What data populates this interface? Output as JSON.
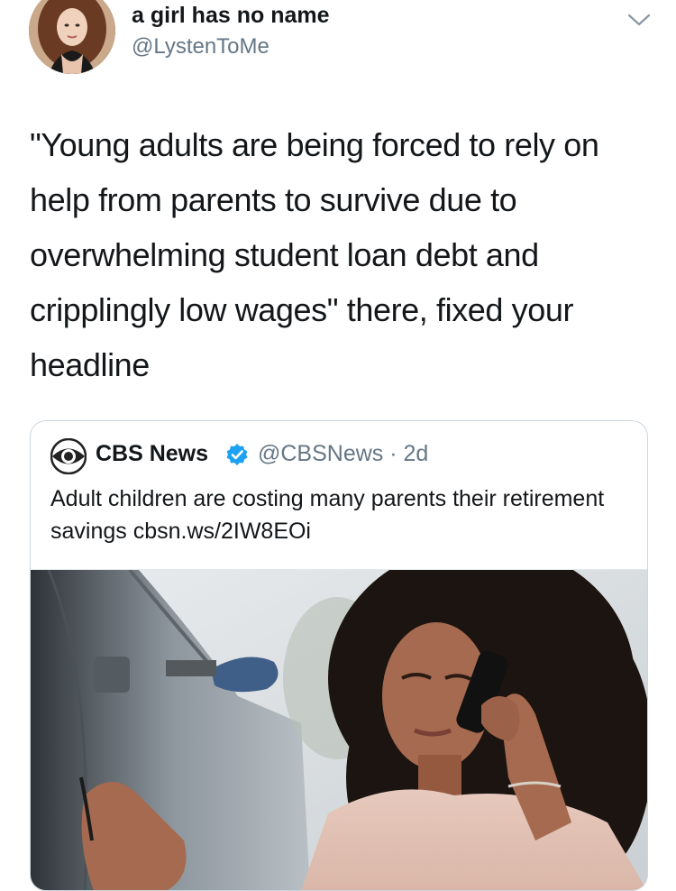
{
  "author": {
    "display_name": "a girl has no name",
    "handle": "@LystenToMe"
  },
  "tweet": {
    "text": "\"Young adults are being forced to rely on help from parents to survive due to overwhelming student loan debt and cripplingly low wages\" there, fixed your headline"
  },
  "quoted_tweet": {
    "name": "CBS News",
    "meta": "@CBSNews · 2d",
    "text": "Adult children are costing many parents their retirement savings cbsn.ws/2IW8EOi",
    "verified": true
  },
  "icons": {
    "avatar": "profile-photo",
    "menu": "chevron-down-icon",
    "logo": "cbs-eye-logo",
    "verified": "verified-badge-icon"
  },
  "colors": {
    "text": "#14171a",
    "secondary_text": "#657786",
    "border": "#ccd6dd",
    "verified": "#1da1f2"
  }
}
